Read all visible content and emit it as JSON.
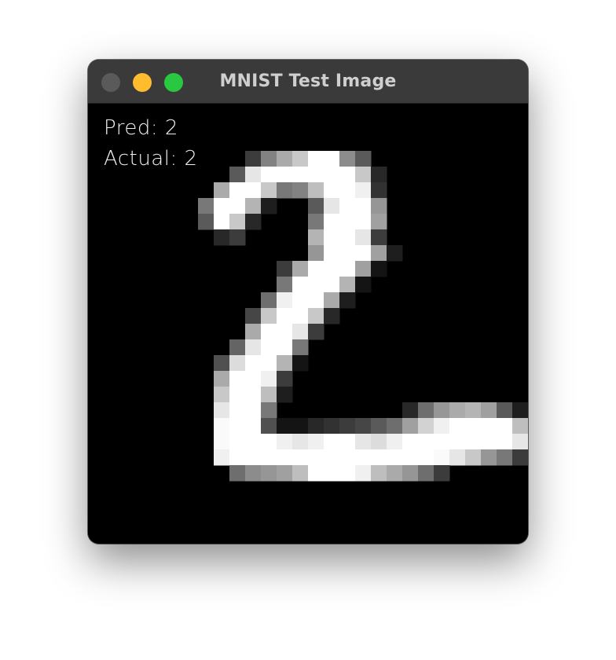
{
  "window": {
    "title": "MNIST Test Image",
    "traffic_lights": {
      "close": {
        "icon": "close-traffic-light-icon",
        "color": "#5a5a5a"
      },
      "minimize": {
        "icon": "minimize-traffic-light-icon",
        "color": "#febc2e"
      },
      "maximize": {
        "icon": "maximize-traffic-light-icon",
        "color": "#28c840"
      }
    }
  },
  "overlay": {
    "pred_text": "Pred: 2",
    "actual_text": "Actual: 2"
  },
  "colors": {
    "titlebar": "#3a3a3a",
    "title_text": "#cfcfcf",
    "image_background": "#000000",
    "overlay_text": "#f2f2f2"
  }
}
